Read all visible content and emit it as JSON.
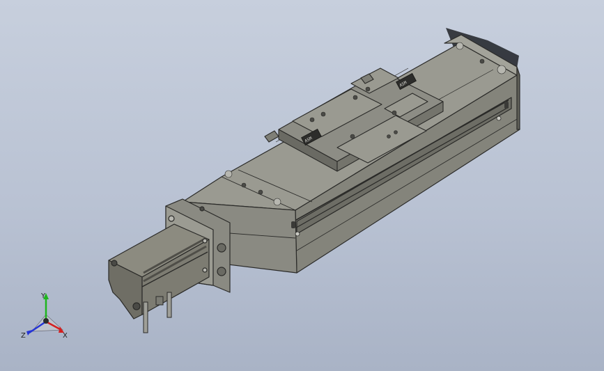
{
  "viewport": {
    "background_top": "#c7cfdd",
    "background_bottom": "#a9b3c6"
  },
  "model": {
    "body_color": "#8f8f86",
    "body_dark": "#5f5f58",
    "edge_color": "#2a2a28",
    "carriage_color": "#8a8a82",
    "motor_color": "#7d7c72",
    "shadow_color": "#1f2126",
    "plate_labels": [
      "ASM",
      "ASM",
      "ASM"
    ]
  },
  "triad": {
    "labels": {
      "x": "X",
      "y": "Y",
      "z": "Z"
    },
    "colors": {
      "x": "#d42020",
      "y": "#1fb51f",
      "z": "#2434d6"
    }
  }
}
